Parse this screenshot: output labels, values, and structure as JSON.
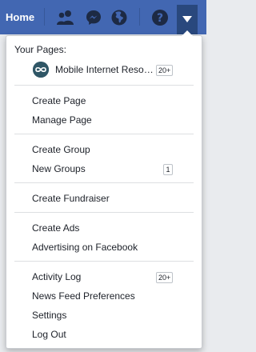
{
  "topbar": {
    "home_label": "Home",
    "icons": [
      "friends-icon",
      "messenger-icon",
      "globe-icon",
      "help-icon",
      "caret-down-icon"
    ],
    "color": "#4267b2"
  },
  "menu": {
    "your_pages_title": "Your Pages:",
    "pages": [
      {
        "name": "Mobile Internet Resource Center",
        "badge": "20+"
      }
    ],
    "sections": [
      {
        "items": [
          {
            "label": "Create Page"
          },
          {
            "label": "Manage Page"
          }
        ]
      },
      {
        "items": [
          {
            "label": "Create Group"
          },
          {
            "label": "New Groups",
            "badge": "1"
          }
        ]
      },
      {
        "items": [
          {
            "label": "Create Fundraiser"
          }
        ]
      },
      {
        "items": [
          {
            "label": "Create Ads"
          },
          {
            "label": "Advertising on Facebook"
          }
        ]
      },
      {
        "items": [
          {
            "label": "Activity Log",
            "badge": "20+"
          },
          {
            "label": "News Feed Preferences"
          },
          {
            "label": "Settings"
          },
          {
            "label": "Log Out"
          }
        ]
      }
    ]
  }
}
